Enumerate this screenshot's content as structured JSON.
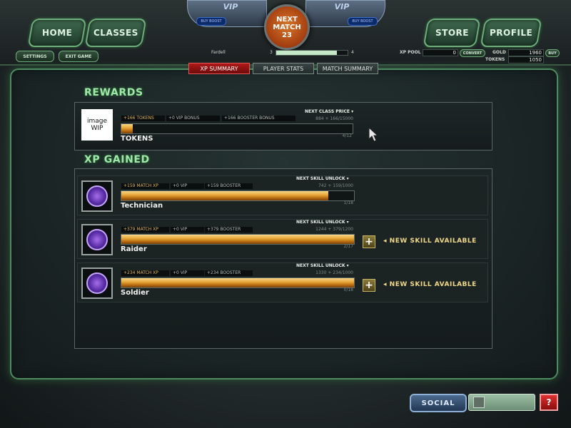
{
  "nav": {
    "home": "HOME",
    "classes": "CLASSES",
    "store": "STORE",
    "profile": "PROFILE",
    "settings": "SETTINGS",
    "exit_game": "EXIT GAME"
  },
  "vip": {
    "label": "VIP",
    "boost": "BUY BOOST"
  },
  "next_match": {
    "line1": "NEXT",
    "line2": "MATCH",
    "count": "23"
  },
  "player": {
    "name": "Fardell",
    "level_current": "3",
    "level_next": "4",
    "level_progress": 0.85
  },
  "wallet": {
    "xp_pool_label": "XP POOL",
    "xp_pool": "0",
    "convert": "CONVERT",
    "gold_label": "GOLD",
    "gold": "1960",
    "buy": "BUY",
    "tokens_label": "TOKENS",
    "tokens": "1050"
  },
  "tabs": [
    "XP SUMMARY",
    "PLAYER STATS",
    "MATCH SUMMARY"
  ],
  "rewards": {
    "title": "REWARDS",
    "image_placeholder": "image WIP",
    "name": "TOKENS",
    "pills": [
      "+166 TOKENS",
      "+0 VIP BONUS",
      "+166 BOOSTER BONUS"
    ],
    "next_label": "NEXT CLASS PRICE",
    "progress_text": "884 + 166/15000",
    "count": "4/12",
    "fill": 0.05
  },
  "xp_gained": {
    "title": "XP GAINED",
    "skills": [
      {
        "name": "Technician",
        "pills": [
          "+159 MATCH XP",
          "+0 VIP",
          "+159 BOOSTER"
        ],
        "next_label": "NEXT SKILL UNLOCK",
        "progress_text": "742 + 159/1000",
        "count": "1/18",
        "fill": 0.89,
        "new_skill": false
      },
      {
        "name": "Raider",
        "pills": [
          "+379 MATCH XP",
          "+0 VIP",
          "+379 BOOSTER"
        ],
        "next_label": "NEXT SKILL UNLOCK",
        "progress_text": "1244 + 379/1200",
        "count": "2/17",
        "fill": 1.0,
        "new_skill": true
      },
      {
        "name": "Soldier",
        "pills": [
          "+234 MATCH XP",
          "+0 VIP",
          "+234 BOOSTER"
        ],
        "next_label": "NEXT SKILL UNLOCK",
        "progress_text": "1330 + 234/1000",
        "count": "0/18",
        "fill": 1.0,
        "new_skill": true
      }
    ],
    "new_skill_text": "NEW SKILL AVAILABLE",
    "plus": "+"
  },
  "social": {
    "label": "SOCIAL",
    "help": "?"
  },
  "colors": {
    "accent_green": "#9fe8a8",
    "xp_bar": "#e9a83a",
    "active_tab": "#b11818"
  },
  "icons": {
    "skill": "crosshair-icon",
    "help": "question-icon",
    "avatar": "person-icon"
  }
}
